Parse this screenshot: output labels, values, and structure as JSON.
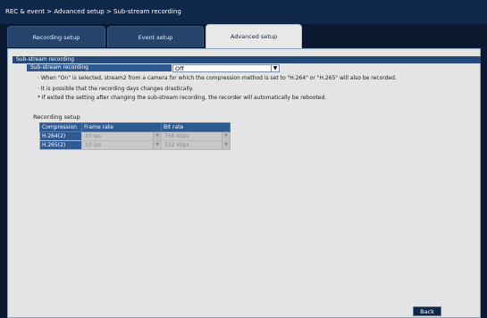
{
  "breadcrumb": "REC & event > Advanced setup > Sub-stream recording",
  "tabs": [
    {
      "label": "Recording setup"
    },
    {
      "label": "Event setup"
    },
    {
      "label": "Advanced setup"
    }
  ],
  "section": {
    "title": "Sub-stream recording",
    "field_label": "Sub-stream recording",
    "field_value": "Off",
    "notes": [
      "· When \"On\" is selected, stream2 from a camera for which the compression method is set to \"H.264\" or \"H.265\" will also be recorded.",
      "· It is possible that the recording days changes drastically.",
      "* If exited the setting after changing the sub-stream recording, the recorder will automatically be rebooted."
    ]
  },
  "recording_setup": {
    "title": "Recording setup",
    "headers": [
      "Compression",
      "Frame rate",
      "Bit rate"
    ],
    "rows": [
      {
        "compression": "H.264(2)",
        "frame_rate": "10 ips",
        "bit_rate": "768 kbps"
      },
      {
        "compression": "H.265(2)",
        "frame_rate": "10 ips",
        "bit_rate": "512 kbps"
      }
    ]
  },
  "buttons": {
    "back": "Back"
  },
  "colors": {
    "background": "#0a1830",
    "panel": "#e4e4e4",
    "header_blue": "#2f5a92",
    "section_blue": "#254a7a"
  }
}
